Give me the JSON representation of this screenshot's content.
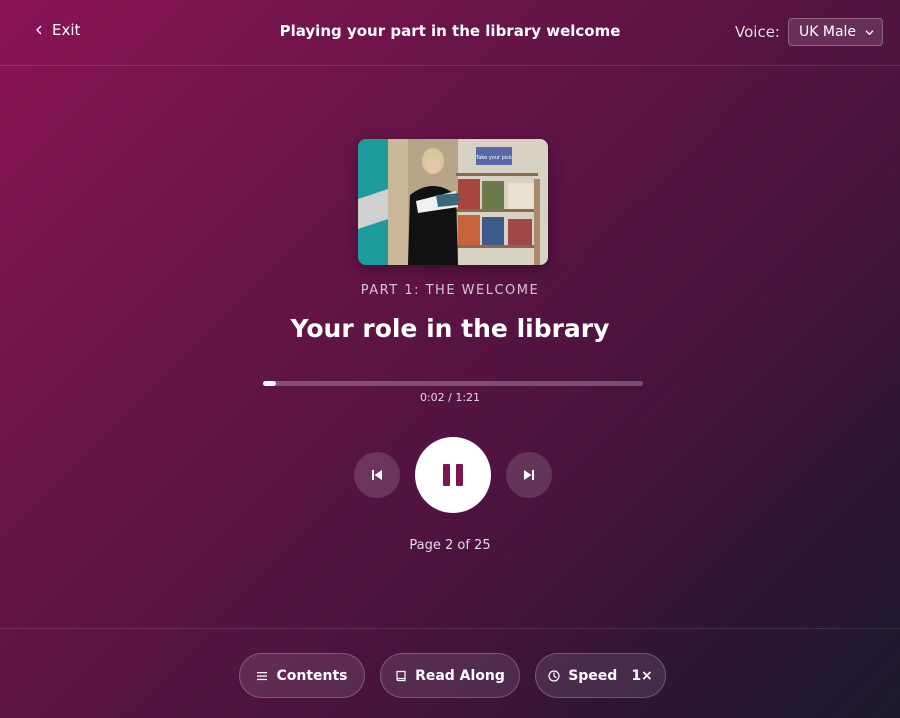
{
  "header": {
    "exit_label": "Exit",
    "title": "Playing your part in the library welcome",
    "voice_label": "Voice:",
    "voice_selected": "UK Male"
  },
  "media": {
    "thumbnail_sign": "Take your pick",
    "part_label": "PART 1: THE WELCOME",
    "chapter_title": "Your role in the library",
    "progress_fraction": 0.033,
    "time_display": "0:02 / 1:21",
    "page_indicator": "Page 2 of 25"
  },
  "footer": {
    "contents_label": "Contents",
    "read_along_label": "Read Along",
    "speed_label": "Speed",
    "speed_value": "1×"
  },
  "icons": {
    "exit": "chevron-left-icon",
    "voice_dropdown": "chevron-down-icon",
    "prev": "skip-previous-icon",
    "play": "pause-icon",
    "next": "skip-next-icon",
    "contents": "list-icon",
    "read_along": "book-icon",
    "speed": "clock-icon"
  },
  "colors": {
    "accent": "#7d1650",
    "background_start": "#8a1456",
    "background_end": "#1c1a2e"
  }
}
